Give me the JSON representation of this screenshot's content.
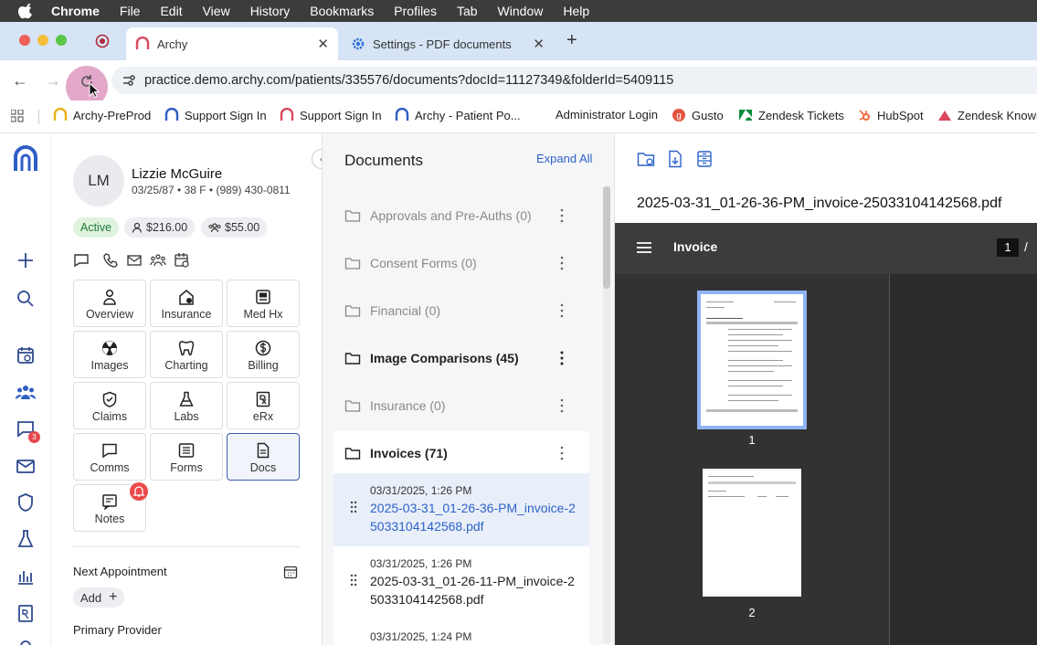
{
  "menubar": {
    "items": [
      "Chrome",
      "File",
      "Edit",
      "View",
      "History",
      "Bookmarks",
      "Profiles",
      "Tab",
      "Window",
      "Help"
    ]
  },
  "tabs": [
    {
      "title": "Archy",
      "active": true
    },
    {
      "title": "Settings - PDF documents",
      "active": false
    }
  ],
  "omnibox": {
    "url": "practice.demo.archy.com/patients/335576/documents?docId=11127349&folderId=5409115"
  },
  "bookmarks": [
    "Archy-PreProd",
    "Support Sign In",
    "Support Sign In",
    "Archy - Patient Po...",
    "Administrator Login",
    "Gusto",
    "Zendesk Tickets",
    "HubSpot",
    "Zendesk Knowl"
  ],
  "rail": {
    "messages_badge": "3"
  },
  "patient": {
    "initials": "LM",
    "name": "Lizzie McGuire",
    "info": "03/25/87 • 38 F • (989) 430-0811",
    "status": "Active",
    "patient_balance": "$216.00",
    "family_balance": "$55.00",
    "nav": [
      {
        "label": "Overview",
        "icon": "person-icon"
      },
      {
        "label": "Insurance",
        "icon": "house-shield-icon"
      },
      {
        "label": "Med Hx",
        "icon": "medical-history-icon"
      },
      {
        "label": "Images",
        "icon": "radiation-icon"
      },
      {
        "label": "Charting",
        "icon": "tooth-icon"
      },
      {
        "label": "Billing",
        "icon": "dollar-circle-icon"
      },
      {
        "label": "Claims",
        "icon": "shield-check-icon"
      },
      {
        "label": "Labs",
        "icon": "flask-icon"
      },
      {
        "label": "eRx",
        "icon": "prescription-icon"
      },
      {
        "label": "Comms",
        "icon": "chat-icon"
      },
      {
        "label": "Forms",
        "icon": "forms-icon"
      },
      {
        "label": "Docs",
        "icon": "document-icon"
      },
      {
        "label": "Notes",
        "icon": "notes-icon"
      }
    ],
    "next_appointment_label": "Next Appointment",
    "add_label": "Add",
    "primary_provider_label": "Primary Provider"
  },
  "documents": {
    "title": "Documents",
    "expand_all": "Expand All",
    "folders": [
      {
        "name": "Approvals and Pre-Auths (0)",
        "bold": false
      },
      {
        "name": "Consent Forms (0)",
        "bold": false
      },
      {
        "name": "Financial (0)",
        "bold": false
      },
      {
        "name": "Image Comparisons (45)",
        "bold": true
      },
      {
        "name": "Insurance (0)",
        "bold": false
      },
      {
        "name": "Invoices (71)",
        "bold": true
      }
    ],
    "items": [
      {
        "date": "03/31/2025, 1:26 PM",
        "name": "2025-03-31_01-26-36-PM_invoice-25033104142568.pdf",
        "selected": true
      },
      {
        "date": "03/31/2025, 1:26 PM",
        "name": "2025-03-31_01-26-11-PM_invoice-25033104142568.pdf",
        "selected": false
      },
      {
        "date": "03/31/2025, 1:24 PM",
        "name": "",
        "selected": false
      }
    ]
  },
  "viewer": {
    "filename": "2025-03-31_01-26-36-PM_invoice-25033104142568.pdf",
    "pdf_title": "Invoice",
    "current_page": "1",
    "page_sep": "/",
    "thumbnails": [
      "1",
      "2"
    ]
  },
  "colors": {
    "accent": "#2c62c9",
    "brand": "#2f5ec4",
    "tabstrip": "#d6e4f5",
    "pdf_toolbar": "#3c3c3c"
  }
}
